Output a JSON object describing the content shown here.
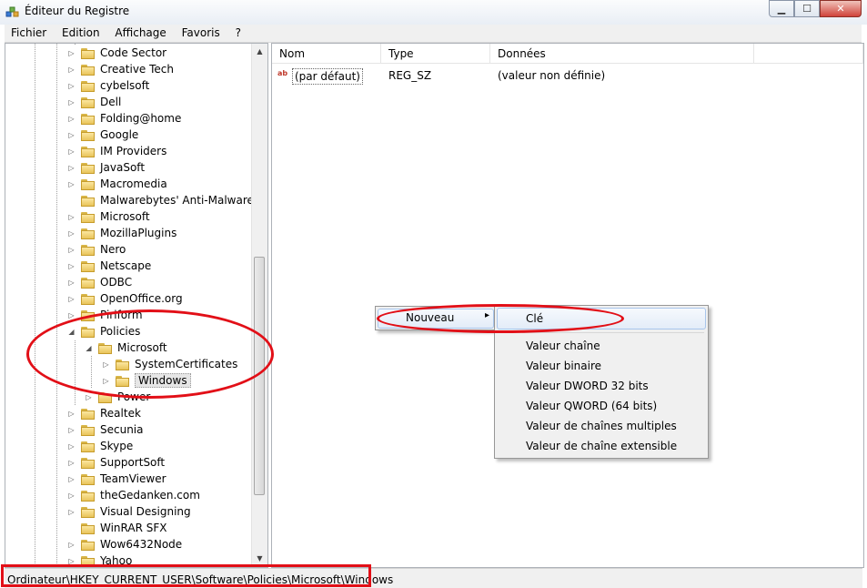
{
  "window": {
    "title": "Éditeur du Registre",
    "minimize": "▁",
    "maximize": "☐",
    "close": "✕"
  },
  "menu": [
    "Fichier",
    "Edition",
    "Affichage",
    "Favoris",
    "?"
  ],
  "tree": {
    "items": [
      {
        "label": "Code Sector",
        "level": 0,
        "expander": "▷"
      },
      {
        "label": "Creative Tech",
        "level": 0,
        "expander": "▷"
      },
      {
        "label": "cybelsoft",
        "level": 0,
        "expander": "▷"
      },
      {
        "label": "Dell",
        "level": 0,
        "expander": "▷"
      },
      {
        "label": "Folding@home",
        "level": 0,
        "expander": "▷"
      },
      {
        "label": "Google",
        "level": 0,
        "expander": "▷"
      },
      {
        "label": "IM Providers",
        "level": 0,
        "expander": "▷"
      },
      {
        "label": "JavaSoft",
        "level": 0,
        "expander": "▷"
      },
      {
        "label": "Macromedia",
        "level": 0,
        "expander": "▷"
      },
      {
        "label": "Malwarebytes' Anti-Malware",
        "level": 0,
        "expander": ""
      },
      {
        "label": "Microsoft",
        "level": 0,
        "expander": "▷"
      },
      {
        "label": "MozillaPlugins",
        "level": 0,
        "expander": "▷"
      },
      {
        "label": "Nero",
        "level": 0,
        "expander": "▷"
      },
      {
        "label": "Netscape",
        "level": 0,
        "expander": "▷"
      },
      {
        "label": "ODBC",
        "level": 0,
        "expander": "▷"
      },
      {
        "label": "OpenOffice.org",
        "level": 0,
        "expander": "▷"
      },
      {
        "label": "Piriform",
        "level": 0,
        "expander": "▷"
      },
      {
        "label": "Policies",
        "level": 0,
        "expander": "◢"
      },
      {
        "label": "Microsoft",
        "level": 1,
        "expander": "◢"
      },
      {
        "label": "SystemCertificates",
        "level": 2,
        "expander": "▷"
      },
      {
        "label": "Windows",
        "level": 2,
        "expander": "▷",
        "selected": true
      },
      {
        "label": "Power",
        "level": 1,
        "expander": "▷"
      },
      {
        "label": "Realtek",
        "level": 0,
        "expander": "▷"
      },
      {
        "label": "Secunia",
        "level": 0,
        "expander": "▷"
      },
      {
        "label": "Skype",
        "level": 0,
        "expander": "▷"
      },
      {
        "label": "SupportSoft",
        "level": 0,
        "expander": "▷"
      },
      {
        "label": "TeamViewer",
        "level": 0,
        "expander": "▷"
      },
      {
        "label": "theGedanken.com",
        "level": 0,
        "expander": "▷"
      },
      {
        "label": "Visual Designing",
        "level": 0,
        "expander": "▷"
      },
      {
        "label": "WinRAR SFX",
        "level": 0,
        "expander": ""
      },
      {
        "label": "Wow6432Node",
        "level": 0,
        "expander": "▷"
      },
      {
        "label": "Yahoo",
        "level": 0,
        "expander": "▷"
      }
    ],
    "scroll_up": "▲",
    "scroll_down": "▼"
  },
  "list": {
    "columns": [
      "Nom",
      "Type",
      "Données"
    ],
    "rows": [
      {
        "name": "(par défaut)",
        "type": "REG_SZ",
        "data": "(valeur non définie)",
        "icon": "ab"
      }
    ]
  },
  "context_menu": {
    "item": "Nouveau",
    "arrow": "▸",
    "submenu": [
      "Clé",
      "Valeur chaîne",
      "Valeur binaire",
      "Valeur DWORD 32 bits",
      "Valeur QWORD (64 bits)",
      "Valeur de chaînes multiples",
      "Valeur de chaîne extensible"
    ]
  },
  "status_bar": {
    "path": "Ordinateur\\HKEY_CURRENT_USER\\Software\\Policies\\Microsoft\\Windows"
  },
  "colors": {
    "annotation_red": "#e20f17",
    "selection_blue": "#a8c5eb"
  }
}
